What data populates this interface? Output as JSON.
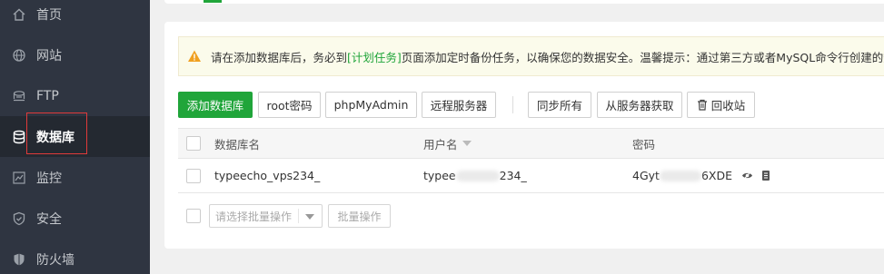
{
  "sidebar": {
    "items": [
      {
        "label": "首页",
        "icon": "home-icon"
      },
      {
        "label": "网站",
        "icon": "globe-icon"
      },
      {
        "label": "FTP",
        "icon": "ftp-icon"
      },
      {
        "label": "数据库",
        "icon": "database-icon",
        "active": true
      },
      {
        "label": "监控",
        "icon": "monitor-icon"
      },
      {
        "label": "安全",
        "icon": "shield-icon"
      },
      {
        "label": "防火墙",
        "icon": "firewall-icon"
      }
    ]
  },
  "notice": {
    "text_before": "请在添加数据库后，务必到",
    "link": "[计划任务]",
    "text_after": "页面添加定时备份任务，以确保您的数据安全。温馨提示：通过第三方或者MySQL命令行创建的数据库"
  },
  "toolbar": {
    "add_db": "添加数据库",
    "root_pwd": "root密码",
    "phpmyadmin": "phpMyAdmin",
    "remote_server": "远程服务器",
    "sync_all": "同步所有",
    "fetch_server": "从服务器获取",
    "recycle": "回收站"
  },
  "table": {
    "columns": {
      "name": "数据库名",
      "user": "用户名",
      "password": "密码"
    },
    "rows": [
      {
        "name": "typeecho_vps234_",
        "user_prefix": "typee",
        "user_suffix": "234_",
        "pwd_prefix": "4Gyt",
        "pwd_suffix": "6XDE"
      }
    ]
  },
  "batch": {
    "placeholder": "请选择批量操作",
    "button": "批量操作"
  },
  "colors": {
    "accent": "#20a53a",
    "sidebar_bg": "#2f3541",
    "highlight": "#e03a3a"
  }
}
